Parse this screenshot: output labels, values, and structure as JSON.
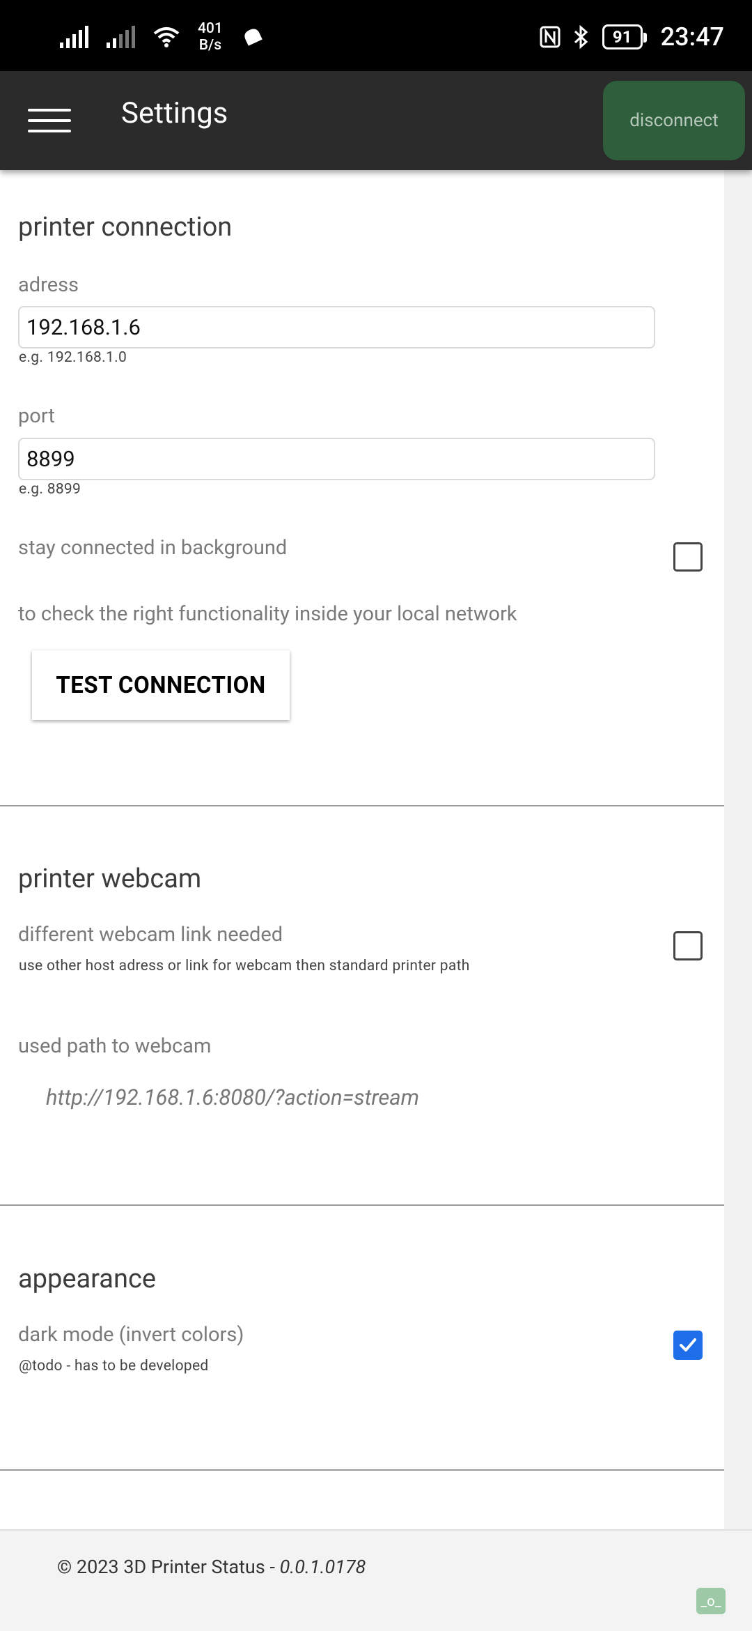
{
  "status_bar": {
    "net_speed_value": "401",
    "net_speed_unit": "B/s",
    "battery": "91",
    "time": "23:47"
  },
  "appbar": {
    "title": "Settings",
    "disconnect_label": "disconnect"
  },
  "printer_connection": {
    "heading": "printer connection",
    "address_label": "adress",
    "address_value": "192.168.1.6",
    "address_hint": "e.g. 192.168.1.0",
    "port_label": "port",
    "port_value": "8899",
    "port_hint": "e.g. 8899",
    "background_label": "stay connected in background",
    "background_checked": false,
    "test_info": "to check the right functionality inside your local network",
    "test_button": "TEST CONNECTION"
  },
  "printer_webcam": {
    "heading": "printer webcam",
    "diff_link_label": "different webcam link needed",
    "diff_link_hint": "use other host adress or link for webcam then standard printer path",
    "diff_link_checked": false,
    "path_label": "used path to webcam",
    "path_value": "http://192.168.1.6:8080/?action=stream"
  },
  "appearance": {
    "heading": "appearance",
    "dark_mode_label": "dark mode (invert colors)",
    "dark_mode_hint": "@todo - has to be developed",
    "dark_mode_checked": true
  },
  "footer": {
    "copyright": "© 2023 3D Printer Status - ",
    "version": "0.0.1.0178",
    "badge": "_o_"
  },
  "colors": {
    "appbar": "#2b2b2b",
    "disconnect_bg": "#2e5e3b",
    "checkbox_checked": "#1d6ee8"
  }
}
